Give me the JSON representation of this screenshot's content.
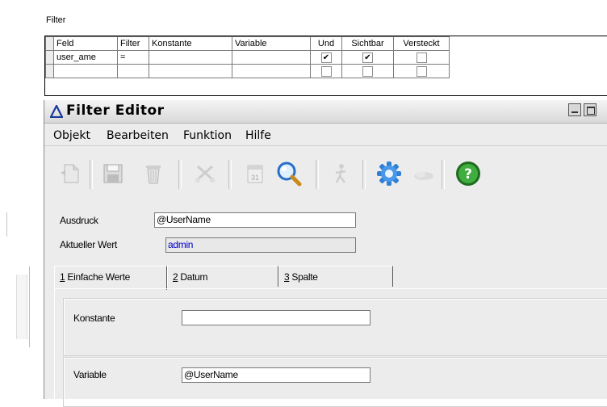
{
  "background_panel": {
    "title": "Filter",
    "columns": [
      "Feld",
      "Filter",
      "Konstante",
      "Variable",
      "Und",
      "Sichtbar",
      "Versteckt"
    ],
    "rows": [
      {
        "feld": "user_ame",
        "filter": "=",
        "konstante": "",
        "variable": "",
        "und": true,
        "sichtbar": true,
        "versteckt": false
      },
      {
        "feld": "",
        "filter": "",
        "konstante": "",
        "variable": "",
        "und": false,
        "sichtbar": false,
        "versteckt": false
      }
    ]
  },
  "window": {
    "title": "Filter Editor",
    "menu": [
      "Objekt",
      "Bearbeiten",
      "Funktion",
      "Hilfe"
    ],
    "toolbar_icons": [
      "new-document-icon",
      "save-icon",
      "delete-icon",
      "cut-icon",
      "calendar-icon",
      "search-icon",
      "run-icon",
      "settings-icon",
      "cloud-icon",
      "help-icon"
    ],
    "calendar_icon_text": "31",
    "help_icon_text": "?",
    "expression": {
      "label": "Ausdruck",
      "value": "@UserName"
    },
    "current_value": {
      "label": "Aktueller Wert",
      "value": "admin"
    },
    "tabs": [
      {
        "num": "1",
        "rest": " Einfache Werte"
      },
      {
        "num": "2",
        "rest": " Datum"
      },
      {
        "num": "3",
        "rest": " Spalte"
      }
    ],
    "constant": {
      "label": "Konstante",
      "value": ""
    },
    "variable": {
      "label": "Variable",
      "value": "@UserName"
    }
  },
  "colors": {
    "current_value_text": "#0000cc",
    "help_green": "#2e9a2e",
    "accent_blue": "#2a6fc7"
  }
}
